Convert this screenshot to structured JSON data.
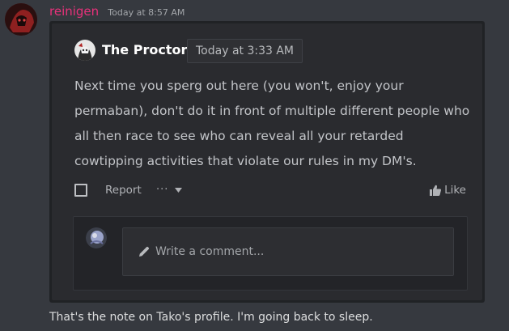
{
  "message": {
    "author": "reinigen",
    "timestamp": "Today at 8:57 AM",
    "author_color": "#e9317b",
    "avatar_icon": "user-avatar"
  },
  "embed": {
    "author": "The Proctor",
    "timestamp": "Today at 3:33 AM",
    "avatar_icon": "user-avatar",
    "body": "Next time you sperg out here (you won't, enjoy your permaban), don't do it in front of multiple different people who all then race to see who can reveal all your retarded cowtipping activities that violate our rules in my DM's.",
    "actions": {
      "report_label": "Report",
      "more_label": "···",
      "like_label": "Like"
    },
    "comment": {
      "placeholder": "Write a comment..."
    }
  },
  "follow_up": "That's the note on Tako's profile. I'm going back to sleep.",
  "colors": {
    "background": "#36393f",
    "embed_background": "#2a2b2f",
    "text": "#dcddde"
  }
}
